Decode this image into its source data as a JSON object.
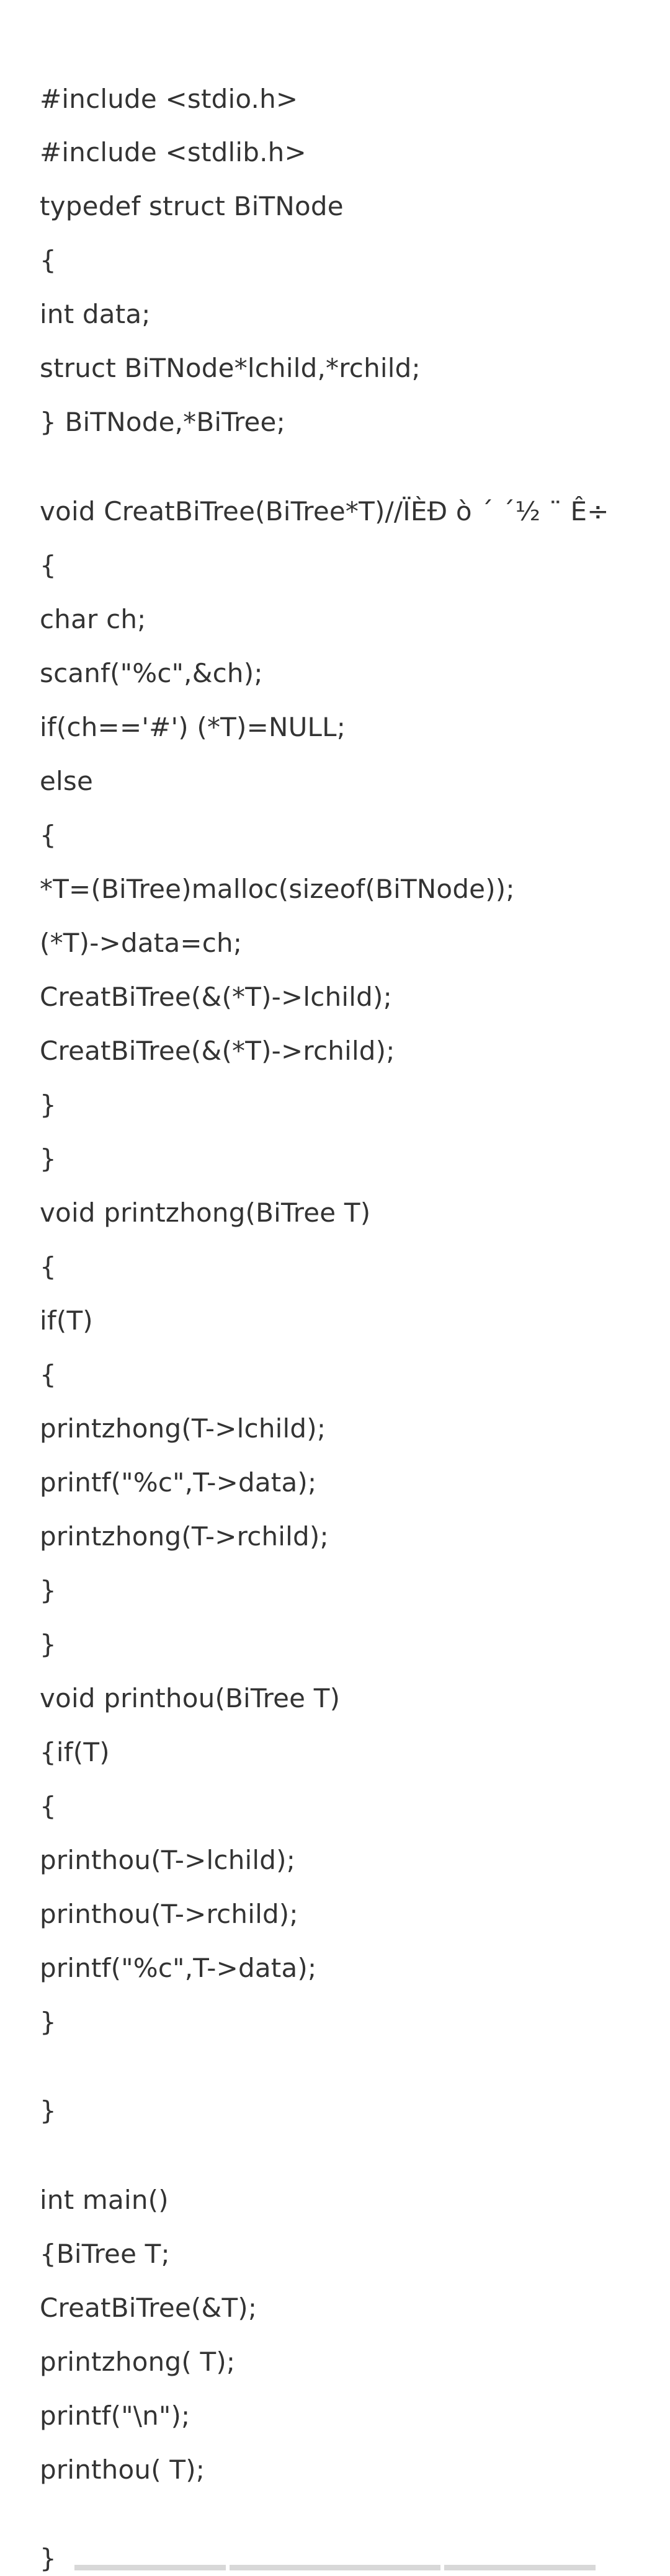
{
  "document": {
    "lines": [
      "#include <stdio.h>",
      "#include <stdlib.h>",
      "typedef struct BiTNode",
      "{",
      "int data;",
      "struct BiTNode*lchild,*rchild;",
      "} BiTNode,*BiTree;",
      "void CreatBiTree(BiTree*T)//ÏÈÐ ò ´ ´½ ¨ Ê÷",
      "{",
      "char ch;",
      "scanf(\"%c\",&ch);",
      "if(ch=='#') (*T)=NULL;",
      "else",
      "{",
      "*T=(BiTree)malloc(sizeof(BiTNode));",
      "(*T)->data=ch;",
      "CreatBiTree(&(*T)->lchild);",
      "CreatBiTree(&(*T)->rchild);",
      "}",
      "}",
      "void printzhong(BiTree T)",
      "{",
      "if(T)",
      "{",
      "printzhong(T->lchild);",
      "printf(\"%c\",T->data);",
      "printzhong(T->rchild);",
      "}",
      "}",
      "void printhou(BiTree T)",
      "{if(T)",
      "{",
      "printhou(T->lchild);",
      "printhou(T->rchild);",
      "printf(\"%c\",T->data);",
      "}",
      "}",
      "int main()",
      "{BiTree T;",
      "CreatBiTree(&T);",
      "printzhong( T);",
      "printf(\"\\n\");",
      "printhou( T);",
      "}"
    ]
  }
}
